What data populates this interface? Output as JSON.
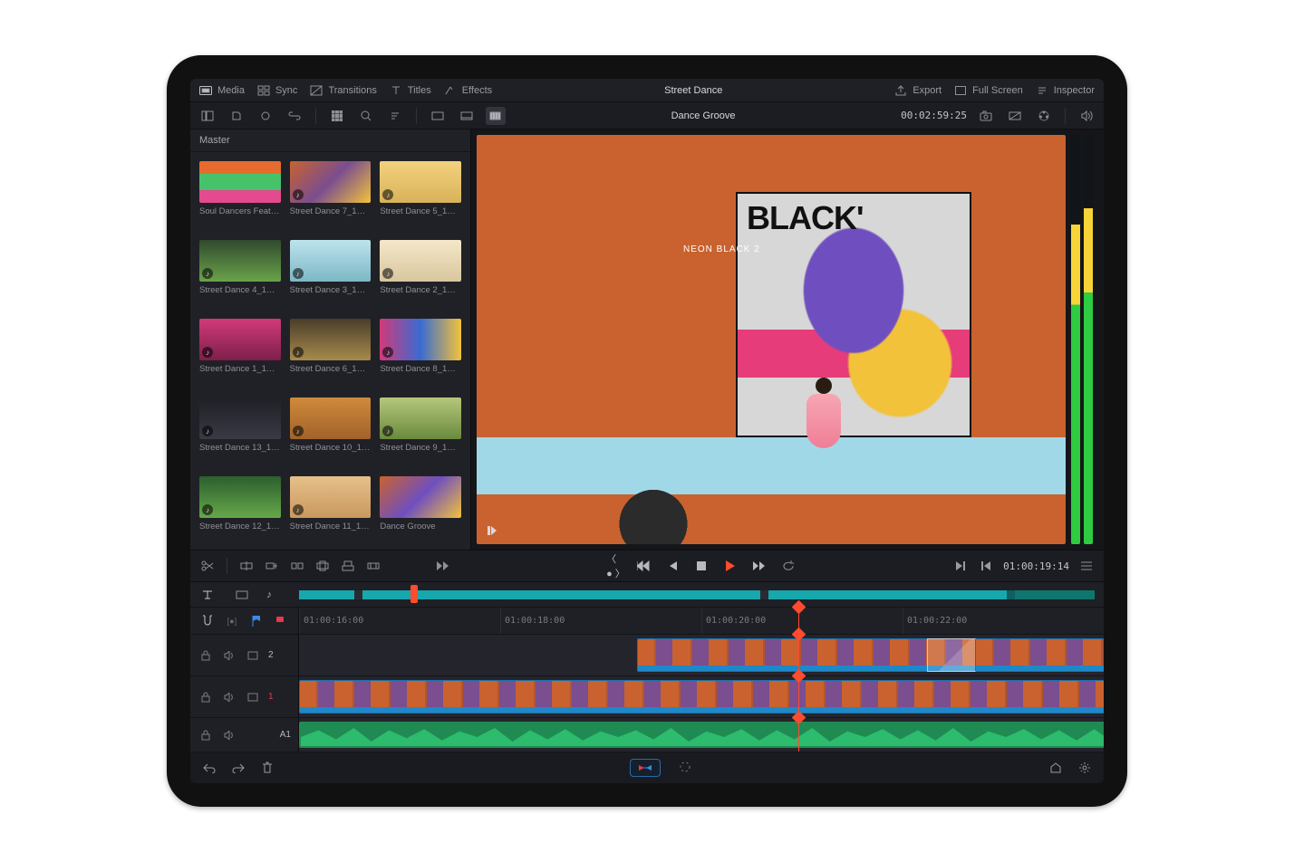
{
  "project_title": "Street Dance",
  "top_tabs": {
    "media": "Media",
    "sync": "Sync",
    "transitions": "Transitions",
    "titles": "Titles",
    "effects": "Effects",
    "export": "Export",
    "fullscreen": "Full Screen",
    "inspector": "Inspector"
  },
  "viewer": {
    "clip_name": "Dance Groove",
    "source_tc": "00:02:59:25",
    "record_tc": "01:00:19:14",
    "mural_big_text": "BLACK'",
    "mural_small_text": "NEON BLACK 2"
  },
  "media_pool": {
    "bin": "Master",
    "clips": [
      {
        "label": "Soul Dancers Feat…",
        "cls": "c-g",
        "audio": false
      },
      {
        "label": "Street Dance 7_1…",
        "cls": "c-a",
        "audio": true
      },
      {
        "label": "Street Dance 5_1…",
        "cls": "c-b",
        "audio": true
      },
      {
        "label": "Street Dance 4_1…",
        "cls": "c-c",
        "audio": true
      },
      {
        "label": "Street Dance 3_1…",
        "cls": "c-d",
        "audio": true
      },
      {
        "label": "Street Dance 2_1…",
        "cls": "c-e",
        "audio": true
      },
      {
        "label": "Street Dance 1_1…",
        "cls": "c-f",
        "audio": true
      },
      {
        "label": "Street Dance 6_1…",
        "cls": "c-h",
        "audio": true
      },
      {
        "label": "Street Dance 8_1…",
        "cls": "c-i",
        "audio": true
      },
      {
        "label": "Street Dance 13_1…",
        "cls": "c-j",
        "audio": true
      },
      {
        "label": "Street Dance 10_1…",
        "cls": "c-k",
        "audio": true
      },
      {
        "label": "Street Dance 9_1…",
        "cls": "c-l",
        "audio": true
      },
      {
        "label": "Street Dance 12_1…",
        "cls": "c-m",
        "audio": true
      },
      {
        "label": "Street Dance 11_1…",
        "cls": "c-n",
        "audio": true
      },
      {
        "label": "Dance Groove",
        "cls": "c-o",
        "audio": false
      }
    ]
  },
  "timeline": {
    "ruler": [
      "01:00:16:00",
      "01:00:18:00",
      "01:00:20:00",
      "01:00:22:00"
    ],
    "tracks": {
      "v2": "2",
      "v1": "1",
      "a1": "A1"
    }
  },
  "colors": {
    "accent_play": "#ff4b2e",
    "clip_blue": "#1e88c9",
    "audio_green": "#2dbb6e",
    "overview_teal": "#17a8ad"
  }
}
